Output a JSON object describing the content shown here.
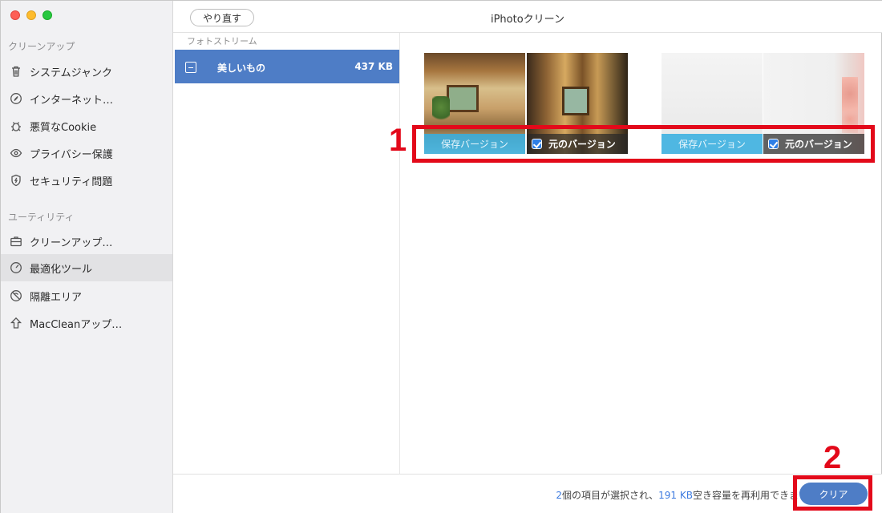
{
  "window": {
    "title": "iPhotoクリーン"
  },
  "toolbar": {
    "redo_label": "やり直す"
  },
  "sidebar": {
    "section_cleanup": "クリーンアップ",
    "cleanup_items": [
      {
        "label": "システムジャンク",
        "icon": "trash-icon"
      },
      {
        "label": "インターネット…",
        "icon": "compass-icon"
      },
      {
        "label": "悪質なCookie",
        "icon": "bug-icon"
      },
      {
        "label": "プライバシー保護",
        "icon": "eye-icon"
      },
      {
        "label": "セキュリティ問題",
        "icon": "shield-icon"
      }
    ],
    "section_utility": "ユーティリティ",
    "utility_items": [
      {
        "label": "クリーンアップ…",
        "icon": "briefcase-icon"
      },
      {
        "label": "最適化ツール",
        "icon": "gauge-icon",
        "selected": true
      },
      {
        "label": "隔離エリア",
        "icon": "quarantine-icon"
      },
      {
        "label": "MacCleanアップ…",
        "icon": "upload-arrow-icon"
      }
    ]
  },
  "list": {
    "header": "フォトストリーム",
    "rows": [
      {
        "name": "美しいもの",
        "size": "437 KB",
        "selected": true
      }
    ]
  },
  "photos": {
    "save_version_label": "保存バージョン",
    "original_version_label": "元のバージョン",
    "pairs": [
      {
        "save_checked": false,
        "original_checked": true
      },
      {
        "save_checked": false,
        "original_checked": true
      }
    ]
  },
  "annotations": {
    "marker1": "1",
    "marker2": "2",
    "color": "#e3091a"
  },
  "footer": {
    "count": "2",
    "text1": "個の項目が選択され、",
    "size": "191 KB",
    "text2": "空き容量を再利用できます",
    "clear_label": "クリア"
  },
  "colors": {
    "accent": "#4e7dc6",
    "link": "#3d7be0"
  }
}
